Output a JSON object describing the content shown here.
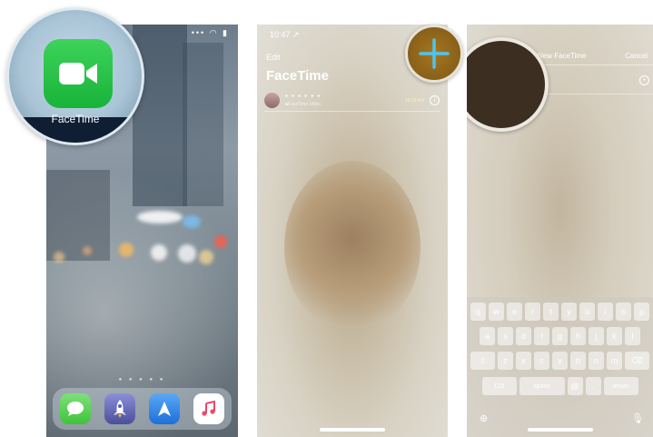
{
  "panel1": {
    "app_label": "FaceTime",
    "status_icons": "••• ◠ ▮",
    "page_dots": "● ● ● ● ●",
    "dock": [
      "messages-icon",
      "rocket-icon",
      "navigation-icon",
      "music-icon"
    ]
  },
  "panel2": {
    "status_time": "10:47 ↗",
    "edit_label": "Edit",
    "title": "FaceTime",
    "contact": {
      "name": "▪ ▪ ▪ ▪ ▪ ▪",
      "subtitle": "■FaceTime Video",
      "time": "10:33 AM",
      "info": "i"
    },
    "plus_icon": "add-icon"
  },
  "panel3": {
    "title": "New FaceTime",
    "cancel_label": "Cancel",
    "add_contact": "+",
    "keyboard": {
      "row1": [
        "q",
        "w",
        "e",
        "r",
        "t",
        "y",
        "u",
        "i",
        "o",
        "p"
      ],
      "row2": [
        "a",
        "s",
        "d",
        "f",
        "g",
        "h",
        "j",
        "k",
        "l"
      ],
      "row3": [
        "z",
        "x",
        "c",
        "v",
        "b",
        "n",
        "m"
      ],
      "shift": "⇧",
      "delete": "⌫",
      "numbers": "123",
      "space": "space",
      "at": "@",
      "dot": ".",
      "return": "return",
      "globe": "⊕",
      "mic": "🎙"
    }
  }
}
